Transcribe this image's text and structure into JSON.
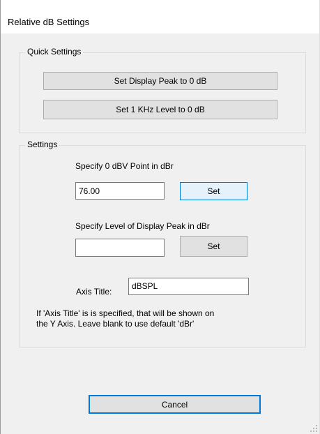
{
  "window": {
    "title": "Relative dB Settings"
  },
  "quick_settings": {
    "title": "Quick Settings",
    "peak_button": "Set Display Peak to 0 dB",
    "khz_button": "Set 1 KHz Level to 0 dB"
  },
  "settings": {
    "title": "Settings",
    "dbv_label": "Specify 0 dBV Point in dBr",
    "dbv_value": "76.00",
    "dbv_set": "Set",
    "peak_label": "Specify Level of Display Peak in dBr",
    "peak_value": "",
    "peak_set": "Set",
    "axis_label": "Axis Title:",
    "axis_value": "dBSPL",
    "note_line1": "If 'Axis Title' is is specified, that will be shown on",
    "note_line2": "the Y Axis. Leave blank to use default 'dBr'"
  },
  "footer": {
    "cancel_label": "Cancel"
  },
  "colors": {
    "accent": "#0078d7",
    "window_bg": "#f0f0f0",
    "button_bg": "#e1e1e1"
  }
}
